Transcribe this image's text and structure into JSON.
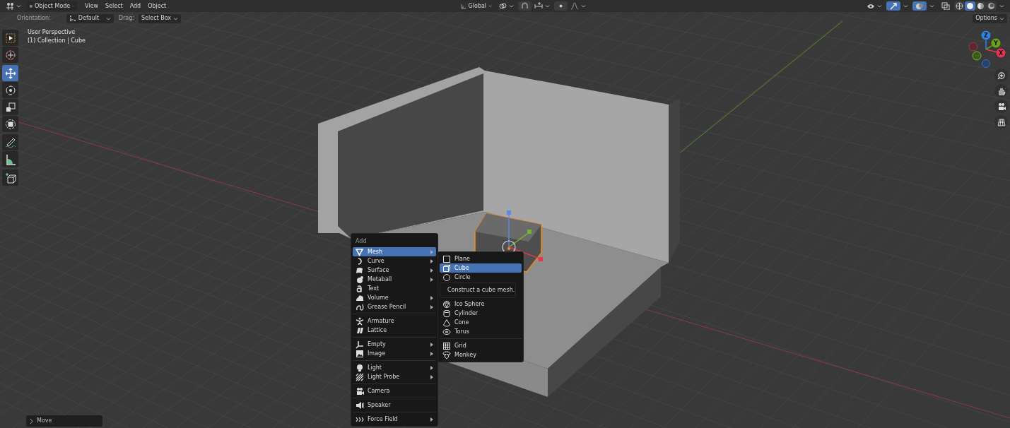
{
  "header": {
    "mode": "Object Mode",
    "menus": [
      "View",
      "Select",
      "Add",
      "Object"
    ],
    "transform_orientation": "Global",
    "snap_on": false,
    "proportional_edit_on": false,
    "gizmos_on": true,
    "overlays_on": true,
    "xray_on": false
  },
  "shading_modes": [
    {
      "kind": "wireframe",
      "selected": false
    },
    {
      "kind": "solid",
      "selected": true
    },
    {
      "kind": "material",
      "selected": false
    },
    {
      "kind": "rendered",
      "selected": false
    }
  ],
  "tool_settings": {
    "orientation_label": "Orientation:",
    "orientation": "Default",
    "drag_label": "Drag:",
    "drag": "Select Box",
    "options": "Options"
  },
  "viewport": {
    "view_name": "User Perspective",
    "collection_info": "(1) Collection | Cube"
  },
  "toolbar": {
    "groups": [
      [
        {
          "kind": "select_box",
          "selected": false
        },
        {
          "kind": "cursor",
          "selected": false
        }
      ],
      [
        {
          "kind": "move",
          "selected": true
        },
        {
          "kind": "rotate",
          "selected": false
        },
        {
          "kind": "scale",
          "selected": false
        },
        {
          "kind": "transform",
          "selected": false
        }
      ],
      [
        {
          "kind": "annotate",
          "selected": false
        },
        {
          "kind": "measure",
          "selected": false
        }
      ],
      [
        {
          "kind": "add_cube",
          "selected": false
        }
      ]
    ]
  },
  "navigation_gizmo": {
    "axes": [
      {
        "label": "Z",
        "color": "#2f83e3"
      },
      {
        "label": "Y",
        "color": "#6ba31c"
      },
      {
        "label": "X",
        "color": "#e8344f"
      }
    ]
  },
  "add_menu": {
    "title": "Add",
    "groups": [
      [
        {
          "label": "Mesh",
          "kind": "mesh",
          "submenu": true,
          "selected": true
        },
        {
          "label": "Curve",
          "kind": "curve",
          "submenu": true,
          "selected": false
        },
        {
          "label": "Surface",
          "kind": "surface",
          "submenu": true,
          "selected": false
        },
        {
          "label": "Metaball",
          "kind": "metaball",
          "submenu": true,
          "selected": false
        },
        {
          "label": "Text",
          "kind": "text",
          "submenu": false,
          "selected": false
        },
        {
          "label": "Volume",
          "kind": "volume",
          "submenu": true,
          "selected": false
        },
        {
          "label": "Grease Pencil",
          "kind": "grease",
          "submenu": true,
          "selected": false
        }
      ],
      [
        {
          "label": "Armature",
          "kind": "armature",
          "submenu": false,
          "selected": false
        },
        {
          "label": "Lattice",
          "kind": "lattice",
          "submenu": false,
          "selected": false
        }
      ],
      [
        {
          "label": "Empty",
          "kind": "empty",
          "submenu": true,
          "selected": false
        },
        {
          "label": "Image",
          "kind": "image",
          "submenu": true,
          "selected": false
        }
      ],
      [
        {
          "label": "Light",
          "kind": "light",
          "submenu": true,
          "selected": false
        },
        {
          "label": "Light Probe",
          "kind": "probe",
          "submenu": true,
          "selected": false
        }
      ],
      [
        {
          "label": "Camera",
          "kind": "camera",
          "submenu": false,
          "selected": false
        }
      ],
      [
        {
          "label": "Speaker",
          "kind": "speaker",
          "submenu": false,
          "selected": false
        }
      ],
      [
        {
          "label": "Force Field",
          "kind": "force",
          "submenu": true,
          "selected": false
        }
      ]
    ]
  },
  "mesh_submenu": {
    "groups": [
      [
        {
          "label": "Plane",
          "kind": "plane",
          "selected": false
        },
        {
          "label": "Cube",
          "kind": "cube",
          "selected": true,
          "tooltip": "Construct a cube mesh."
        },
        {
          "label": "Circle",
          "kind": "circle",
          "selected": false
        },
        {
          "label": "Ico Sphere",
          "kind": "icosphere",
          "selected": false
        },
        {
          "label": "Cylinder",
          "kind": "cylinder",
          "selected": false
        },
        {
          "label": "Cone",
          "kind": "cone",
          "selected": false
        },
        {
          "label": "Torus",
          "kind": "torus",
          "selected": false
        }
      ],
      [
        {
          "label": "Grid",
          "kind": "grid",
          "selected": false
        },
        {
          "label": "Monkey",
          "kind": "monkey",
          "selected": false
        }
      ]
    ]
  },
  "last_operator": {
    "label": "Move",
    "expanded": false
  }
}
